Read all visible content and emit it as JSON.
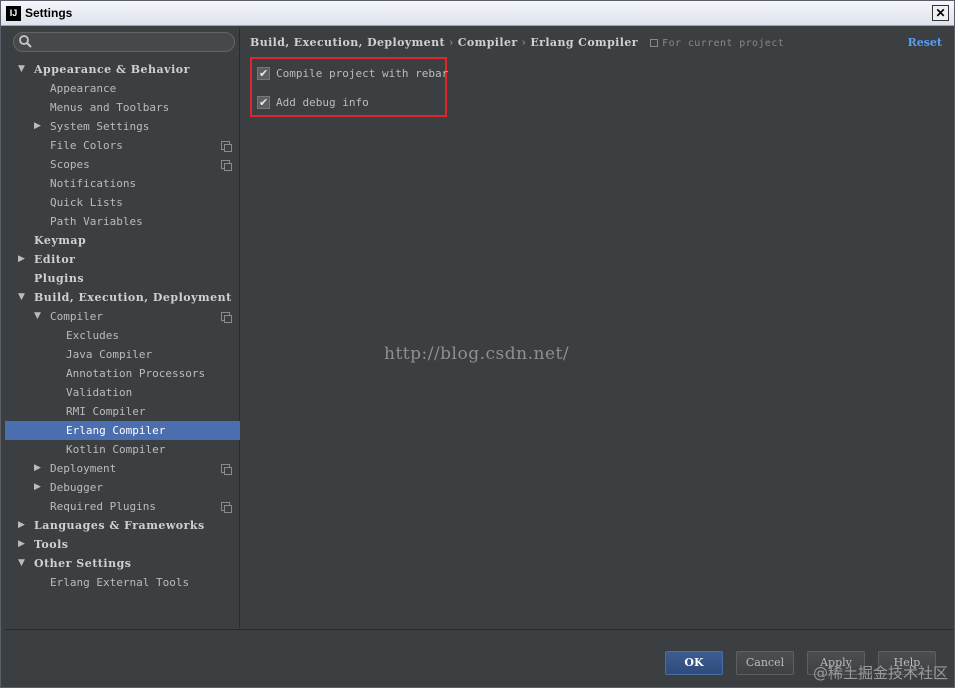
{
  "window": {
    "title": "Settings",
    "app_icon": "IJ",
    "close": "✕"
  },
  "search": {
    "placeholder": ""
  },
  "tree": [
    {
      "label": "Appearance & Behavior",
      "level": 0,
      "arrow": "▼",
      "bold": true
    },
    {
      "label": "Appearance",
      "level": 1
    },
    {
      "label": "Menus and Toolbars",
      "level": 1
    },
    {
      "label": "System Settings",
      "level": 1,
      "arrow": "▶"
    },
    {
      "label": "File Colors",
      "level": 1,
      "project": true
    },
    {
      "label": "Scopes",
      "level": 1,
      "project": true
    },
    {
      "label": "Notifications",
      "level": 1
    },
    {
      "label": "Quick Lists",
      "level": 1
    },
    {
      "label": "Path Variables",
      "level": 1
    },
    {
      "label": "Keymap",
      "level": 0,
      "bold": true
    },
    {
      "label": "Editor",
      "level": 0,
      "arrow": "▶",
      "bold": true
    },
    {
      "label": "Plugins",
      "level": 0,
      "bold": true
    },
    {
      "label": "Build, Execution, Deployment",
      "level": 0,
      "arrow": "▼",
      "bold": true
    },
    {
      "label": "Compiler",
      "level": 1,
      "arrow": "▼",
      "project": true
    },
    {
      "label": "Excludes",
      "level": 2
    },
    {
      "label": "Java Compiler",
      "level": 2
    },
    {
      "label": "Annotation Processors",
      "level": 2
    },
    {
      "label": "Validation",
      "level": 2
    },
    {
      "label": "RMI Compiler",
      "level": 2
    },
    {
      "label": "Erlang Compiler",
      "level": 2,
      "selected": true
    },
    {
      "label": "Kotlin Compiler",
      "level": 2
    },
    {
      "label": "Deployment",
      "level": 1,
      "arrow": "▶",
      "project": true
    },
    {
      "label": "Debugger",
      "level": 1,
      "arrow": "▶"
    },
    {
      "label": "Required Plugins",
      "level": 1,
      "project": true
    },
    {
      "label": "Languages & Frameworks",
      "level": 0,
      "arrow": "▶",
      "bold": true
    },
    {
      "label": "Tools",
      "level": 0,
      "arrow": "▶",
      "bold": true
    },
    {
      "label": "Other Settings",
      "level": 0,
      "arrow": "▼",
      "bold": true
    },
    {
      "label": "Erlang External Tools",
      "level": 1
    }
  ],
  "breadcrumb": {
    "items": [
      "Build, Execution, Deployment",
      "Compiler",
      "Erlang Compiler"
    ],
    "separator": "›",
    "scope": "For current project"
  },
  "reset_label": "Reset",
  "options": [
    {
      "label": "Compile project with rebar",
      "checked": true
    },
    {
      "label": "Add debug info",
      "checked": true
    }
  ],
  "watermark": "http://blog.csdn.net/",
  "buttons": {
    "ok": "OK",
    "cancel": "Cancel",
    "apply": "Apply",
    "help": "Help"
  },
  "corner_watermark": "@稀土掘金技术社区",
  "colors": {
    "selection": "#4b6eaf",
    "link": "#589df6",
    "highlight_box": "#e0262b",
    "background": "#3c3f41"
  }
}
